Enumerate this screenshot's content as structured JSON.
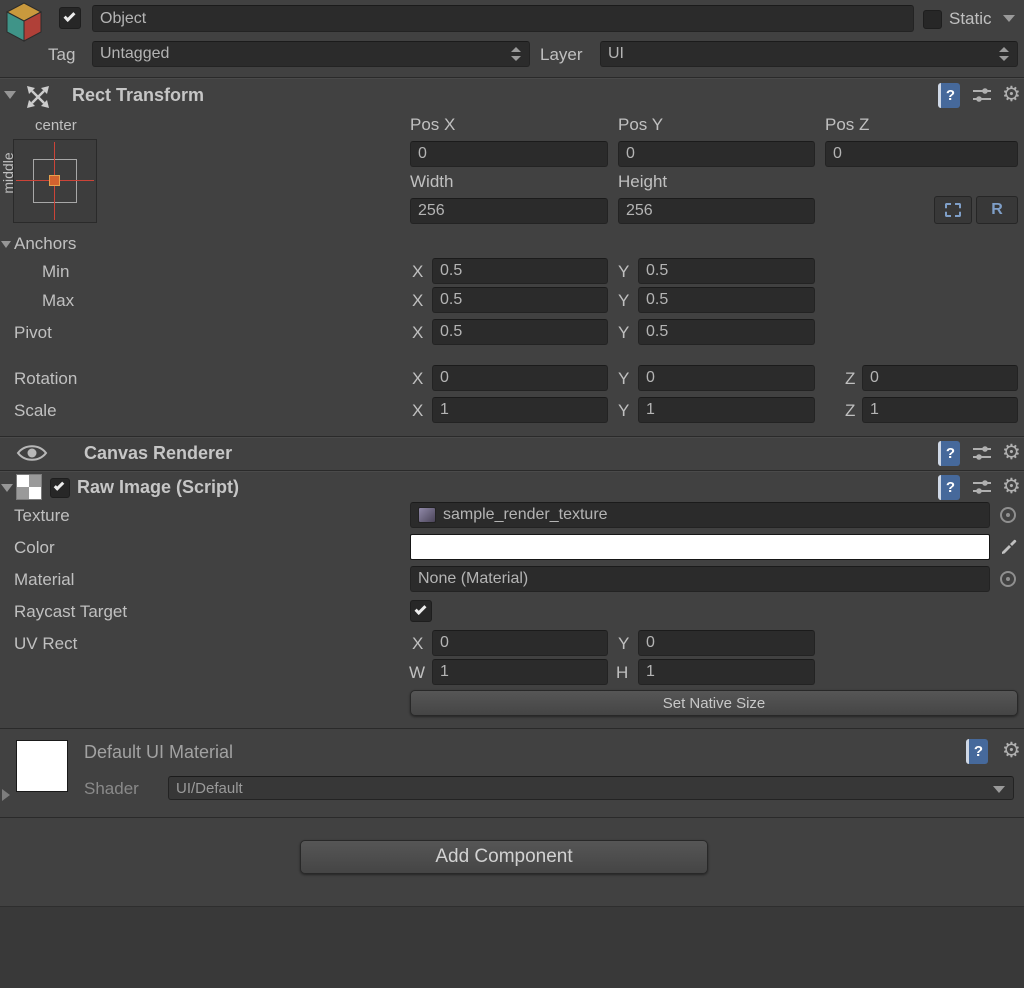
{
  "colors": {
    "accent_blue": "#7f9fc8",
    "crosshair_red": "#cc4438",
    "anchor_orange": "#d2622f"
  },
  "icons": {
    "help": "?",
    "gear": "⚙"
  },
  "header": {
    "name_value": "Object",
    "static_label": "Static",
    "tag_label": "Tag",
    "tag_value": "Untagged",
    "layer_label": "Layer",
    "layer_value": "UI"
  },
  "axis": {
    "x": "X",
    "y": "Y",
    "z": "Z",
    "w": "W",
    "h": "H"
  },
  "rect_transform": {
    "title": "Rect Transform",
    "anchor_top_label": "center",
    "anchor_side_label": "middle",
    "pos_x_label": "Pos X",
    "pos_y_label": "Pos Y",
    "pos_z_label": "Pos Z",
    "pos_x": "0",
    "pos_y": "0",
    "pos_z": "0",
    "width_label": "Width",
    "height_label": "Height",
    "width": "256",
    "height": "256",
    "r_button_label": "R",
    "anchors_label": "Anchors",
    "min_label": "Min",
    "min_x": "0.5",
    "min_y": "0.5",
    "max_label": "Max",
    "max_x": "0.5",
    "max_y": "0.5",
    "pivot_label": "Pivot",
    "pivot_x": "0.5",
    "pivot_y": "0.5",
    "rotation_label": "Rotation",
    "rotation_x": "0",
    "rotation_y": "0",
    "rotation_z": "0",
    "scale_label": "Scale",
    "scale_x": "1",
    "scale_y": "1",
    "scale_z": "1"
  },
  "canvas_renderer": {
    "title": "Canvas Renderer"
  },
  "raw_image": {
    "title": "Raw Image (Script)",
    "texture_label": "Texture",
    "texture_value": "sample_render_texture",
    "color_label": "Color",
    "material_label": "Material",
    "material_value": "None (Material)",
    "raycast_label": "Raycast Target",
    "uv_rect_label": "UV Rect",
    "uv_x": "0",
    "uv_y": "0",
    "uv_w": "1",
    "uv_h": "1",
    "set_native_size_label": "Set Native Size"
  },
  "material_preview": {
    "title": "Default UI Material",
    "shader_label": "Shader",
    "shader_value": "UI/Default"
  },
  "add_component_label": "Add Component"
}
